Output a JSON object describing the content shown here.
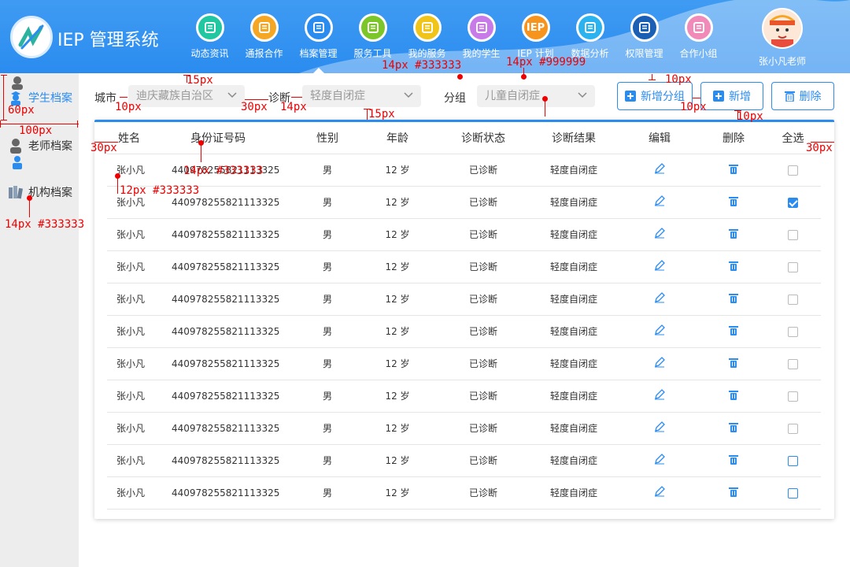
{
  "app": {
    "title": "IEP 管理系统"
  },
  "nav": [
    {
      "label": "动态资讯",
      "color": "#20c7a0",
      "icon": "news-icon"
    },
    {
      "label": "通报合作",
      "color": "#f5a623",
      "icon": "handshake-icon"
    },
    {
      "label": "档案管理",
      "color": "#2b8cf0",
      "icon": "archive-icon"
    },
    {
      "label": "服务工具",
      "color": "#7cc62a",
      "icon": "toolbox-icon"
    },
    {
      "label": "我的服务",
      "color": "#f0c419",
      "icon": "service-icon"
    },
    {
      "label": "我的学生",
      "color": "#c77ae8",
      "icon": "document-icon"
    },
    {
      "label": "IEP 计划",
      "color": "#f7941d",
      "icon": "iep-icon"
    },
    {
      "label": "数据分析",
      "color": "#2bb3f0",
      "icon": "chart-icon"
    },
    {
      "label": "权限管理",
      "color": "#1a5fb4",
      "icon": "lock-icon"
    },
    {
      "label": "合作小组",
      "color": "#f18ab8",
      "icon": "group-icon"
    }
  ],
  "nav_iep_text": "IEP",
  "user": {
    "name": "张小凡老师"
  },
  "sidebar": [
    {
      "label": "学生档案",
      "active": true
    },
    {
      "label": "老师档案",
      "active": false
    },
    {
      "label": "机构档案",
      "active": false
    }
  ],
  "filters": {
    "city_label": "城市",
    "city_value": "迪庆藏族自治区",
    "diagnosis_label": "诊断",
    "diagnosis_value": "轻度自闭症",
    "group_label": "分组",
    "group_value": "儿童自闭症"
  },
  "buttons": {
    "add_group": "新增分组",
    "add": "新增",
    "delete": "删除"
  },
  "table": {
    "headers": [
      "姓名",
      "身份证号码",
      "性别",
      "年龄",
      "诊断状态",
      "诊断结果",
      "编辑",
      "删除",
      "全选"
    ],
    "rows": [
      {
        "name": "张小凡",
        "id": "440978255821113325",
        "gender": "男",
        "age": "12 岁",
        "status": "已诊断",
        "result": "轻度自闭症",
        "checked": false
      },
      {
        "name": "张小凡",
        "id": "440978255821113325",
        "gender": "男",
        "age": "12 岁",
        "status": "已诊断",
        "result": "轻度自闭症",
        "checked": true
      },
      {
        "name": "张小凡",
        "id": "440978255821113325",
        "gender": "男",
        "age": "12 岁",
        "status": "已诊断",
        "result": "轻度自闭症",
        "checked": false
      },
      {
        "name": "张小凡",
        "id": "440978255821113325",
        "gender": "男",
        "age": "12 岁",
        "status": "已诊断",
        "result": "轻度自闭症",
        "checked": false
      },
      {
        "name": "张小凡",
        "id": "440978255821113325",
        "gender": "男",
        "age": "12 岁",
        "status": "已诊断",
        "result": "轻度自闭症",
        "checked": false
      },
      {
        "name": "张小凡",
        "id": "440978255821113325",
        "gender": "男",
        "age": "12 岁",
        "status": "已诊断",
        "result": "轻度自闭症",
        "checked": false
      },
      {
        "name": "张小凡",
        "id": "440978255821113325",
        "gender": "男",
        "age": "12 岁",
        "status": "已诊断",
        "result": "轻度自闭症",
        "checked": false
      },
      {
        "name": "张小凡",
        "id": "440978255821113325",
        "gender": "男",
        "age": "12 岁",
        "status": "已诊断",
        "result": "轻度自闭症",
        "checked": false
      },
      {
        "name": "张小凡",
        "id": "440978255821113325",
        "gender": "男",
        "age": "12 岁",
        "status": "已诊断",
        "result": "轻度自闭症",
        "checked": false
      },
      {
        "name": "张小凡",
        "id": "440978255821113325",
        "gender": "男",
        "age": "12 岁",
        "status": "已诊断",
        "result": "轻度自闭症",
        "checked": false,
        "blue": true
      },
      {
        "name": "张小凡",
        "id": "440978255821113325",
        "gender": "男",
        "age": "12 岁",
        "status": "已诊断",
        "result": "轻度自闭症",
        "checked": false,
        "blue": true
      }
    ]
  },
  "annotations": {
    "a1": "15px",
    "a2": "14px #333333",
    "a3": "14px #999999",
    "a4": "10px",
    "a5": "60px",
    "a6": "10px",
    "a7": "30px",
    "a8": "14px",
    "a9": "10px",
    "a10": "15px",
    "a11": "10px",
    "a12": "100px",
    "a13": "30px",
    "a14": "14px #333333",
    "a15": "30px",
    "a16": "12px #333333",
    "a17": "14px #333333"
  },
  "colors": {
    "primary": "#2b8cf0",
    "annotation": "#ee0000",
    "sidebar_bg": "#ededed"
  }
}
